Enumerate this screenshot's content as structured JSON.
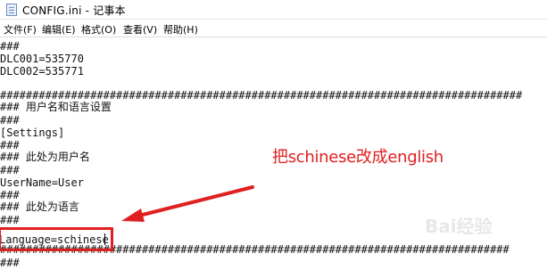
{
  "window": {
    "title": "CONFIG.ini - 记事本"
  },
  "menubar": {
    "items": [
      {
        "label": "文件(F)"
      },
      {
        "label": "编辑(E)"
      },
      {
        "label": "格式(O)"
      },
      {
        "label": "查看(V)"
      },
      {
        "label": "帮助(H)"
      }
    ]
  },
  "editor": {
    "lines": [
      "###",
      "DLC001=535770",
      "DLC002=535771",
      "",
      "#################################################################################",
      "### 用户名和语言设置",
      "###",
      "[Settings]",
      "###",
      "### 此处为用户名",
      "###",
      "UserName=User",
      "###",
      "### 此处为语言",
      "###",
      "Language=schinese",
      "###############################################################################",
      "###"
    ]
  },
  "annotation": {
    "text": "把schinese改成english",
    "color": "#e02020"
  },
  "watermark": {
    "text": "Bai经验"
  },
  "colors": {
    "accent": "#e02020"
  }
}
